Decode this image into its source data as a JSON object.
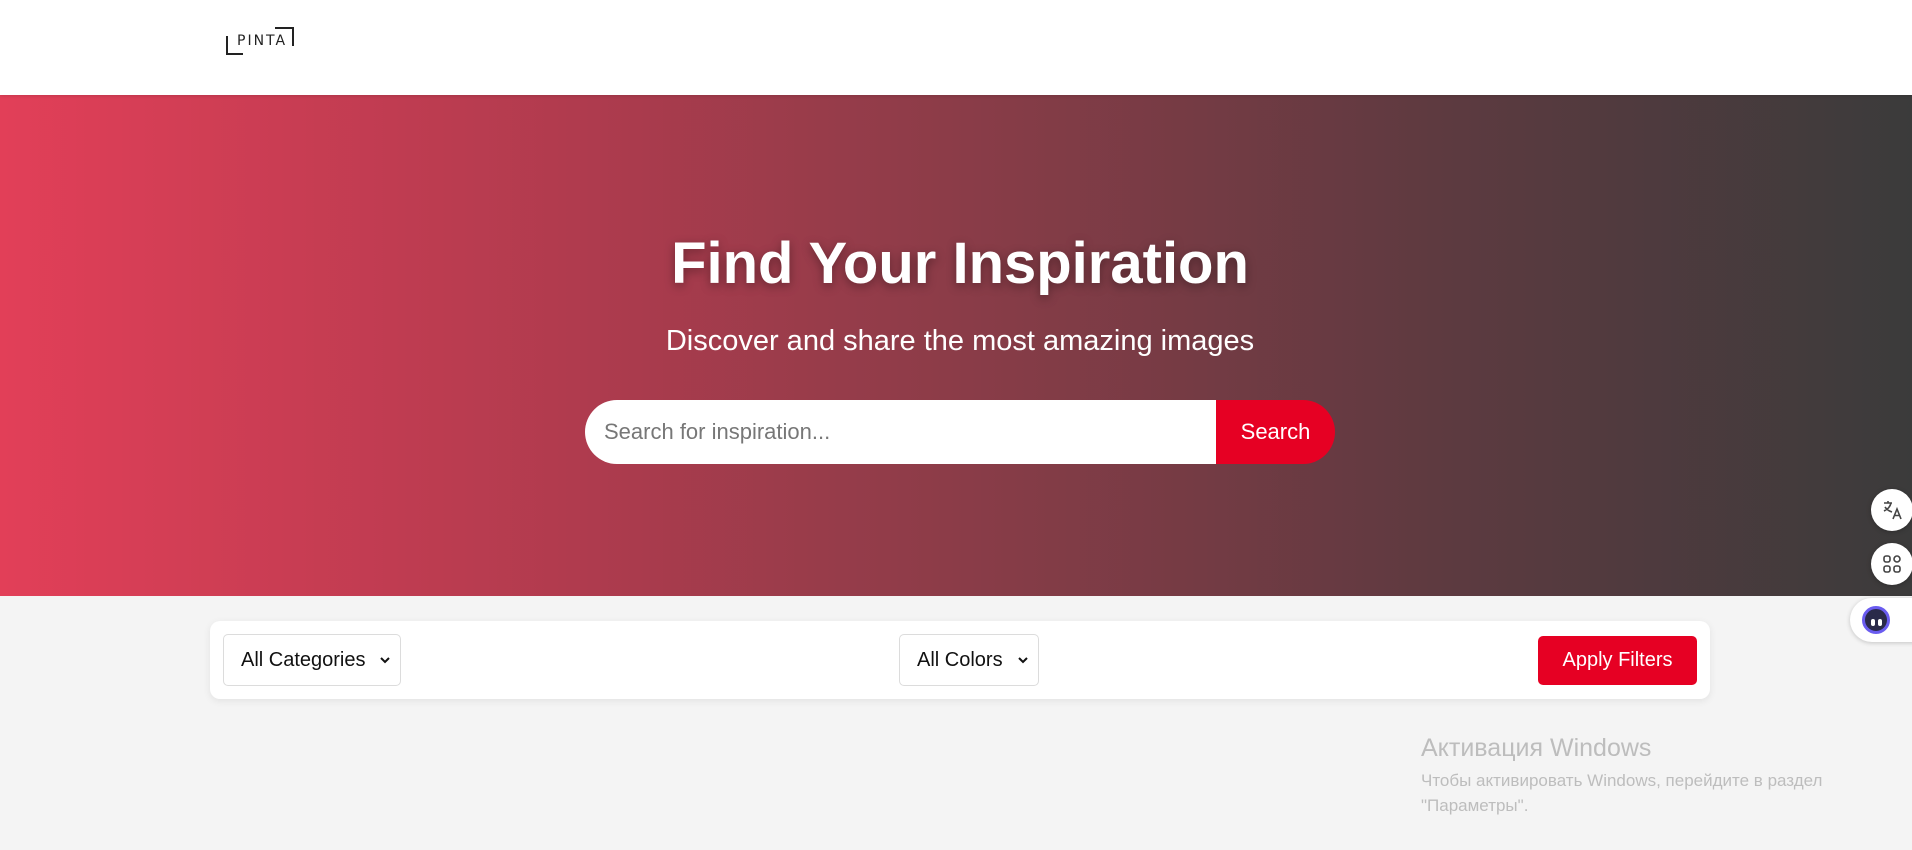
{
  "header": {
    "logo_text": "PINTA"
  },
  "hero": {
    "title": "Find Your Inspiration",
    "subtitle": "Discover and share the most amazing images",
    "search": {
      "placeholder": "Search for inspiration...",
      "value": "",
      "button_label": "Search"
    }
  },
  "filters": {
    "category_selected": "All Categories",
    "color_selected": "All Colors",
    "apply_label": "Apply Filters"
  },
  "side_tools": {
    "icons": [
      "translate-icon",
      "apps-grid-icon",
      "assistant-face-icon"
    ]
  },
  "windows_watermark": {
    "title": "Активация Windows",
    "line1": "Чтобы активировать Windows, перейдите в раздел",
    "line2": "\"Параметры\"."
  },
  "colors": {
    "accent": "#e60023",
    "gradient_start": "#e23f58",
    "gradient_end": "#3b3b3b",
    "page_bg": "#f4f4f4"
  }
}
